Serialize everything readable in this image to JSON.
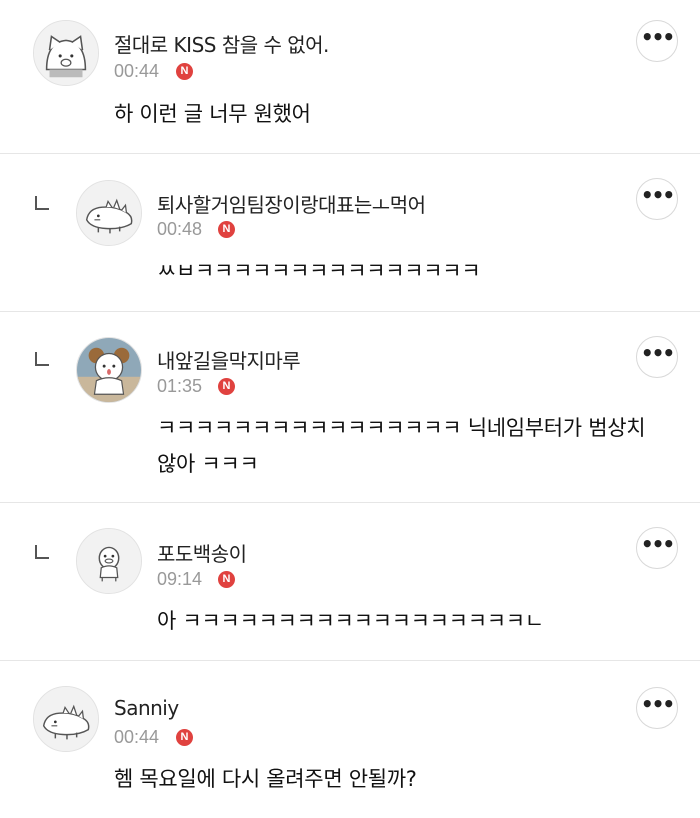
{
  "comments": [
    {
      "author": "절대로 KISS 참을 수 없어.",
      "time": "00:44",
      "badge": "N",
      "body": "하 이런 글 너무 원했어",
      "avatar": "cat-avatar-icon",
      "reply": false
    },
    {
      "author": "퇴사할거임팀장이랑대표는ㅗ먹어",
      "time": "00:48",
      "badge": "N",
      "body": "ㅆㅂㅋㅋㅋㅋㅋㅋㅋㅋㅋㅋㅋㅋㅋㅋㅋ",
      "avatar": "dino-avatar-icon",
      "reply": true
    },
    {
      "author": "내앞길을막지마루",
      "time": "01:35",
      "badge": "N",
      "body": "ㅋㅋㅋㅋㅋㅋㅋㅋㅋㅋㅋㅋㅋㅋㅋㅋ 닉네임부터가 범상치않아 ㅋㅋㅋ",
      "avatar": "sheep-character-avatar-icon",
      "reply": true
    },
    {
      "author": "포도백송이",
      "time": "09:14",
      "badge": "N",
      "body": "아 ㅋㅋㅋㅋㅋㅋㅋㅋㅋㅋㅋㅋㅋㅋㅋㅋㅋㅋㄴ",
      "avatar": "duck-avatar-icon",
      "reply": true
    },
    {
      "author": "Sanniy",
      "time": "00:44",
      "badge": "N",
      "body": "헴 목요일에 다시 올려주면 안될까?",
      "avatar": "dino-avatar-icon",
      "reply": false
    }
  ],
  "more_label": "•••",
  "colors": {
    "badge": "#e0423f",
    "divider": "#e6e6e6",
    "time": "#999999"
  }
}
